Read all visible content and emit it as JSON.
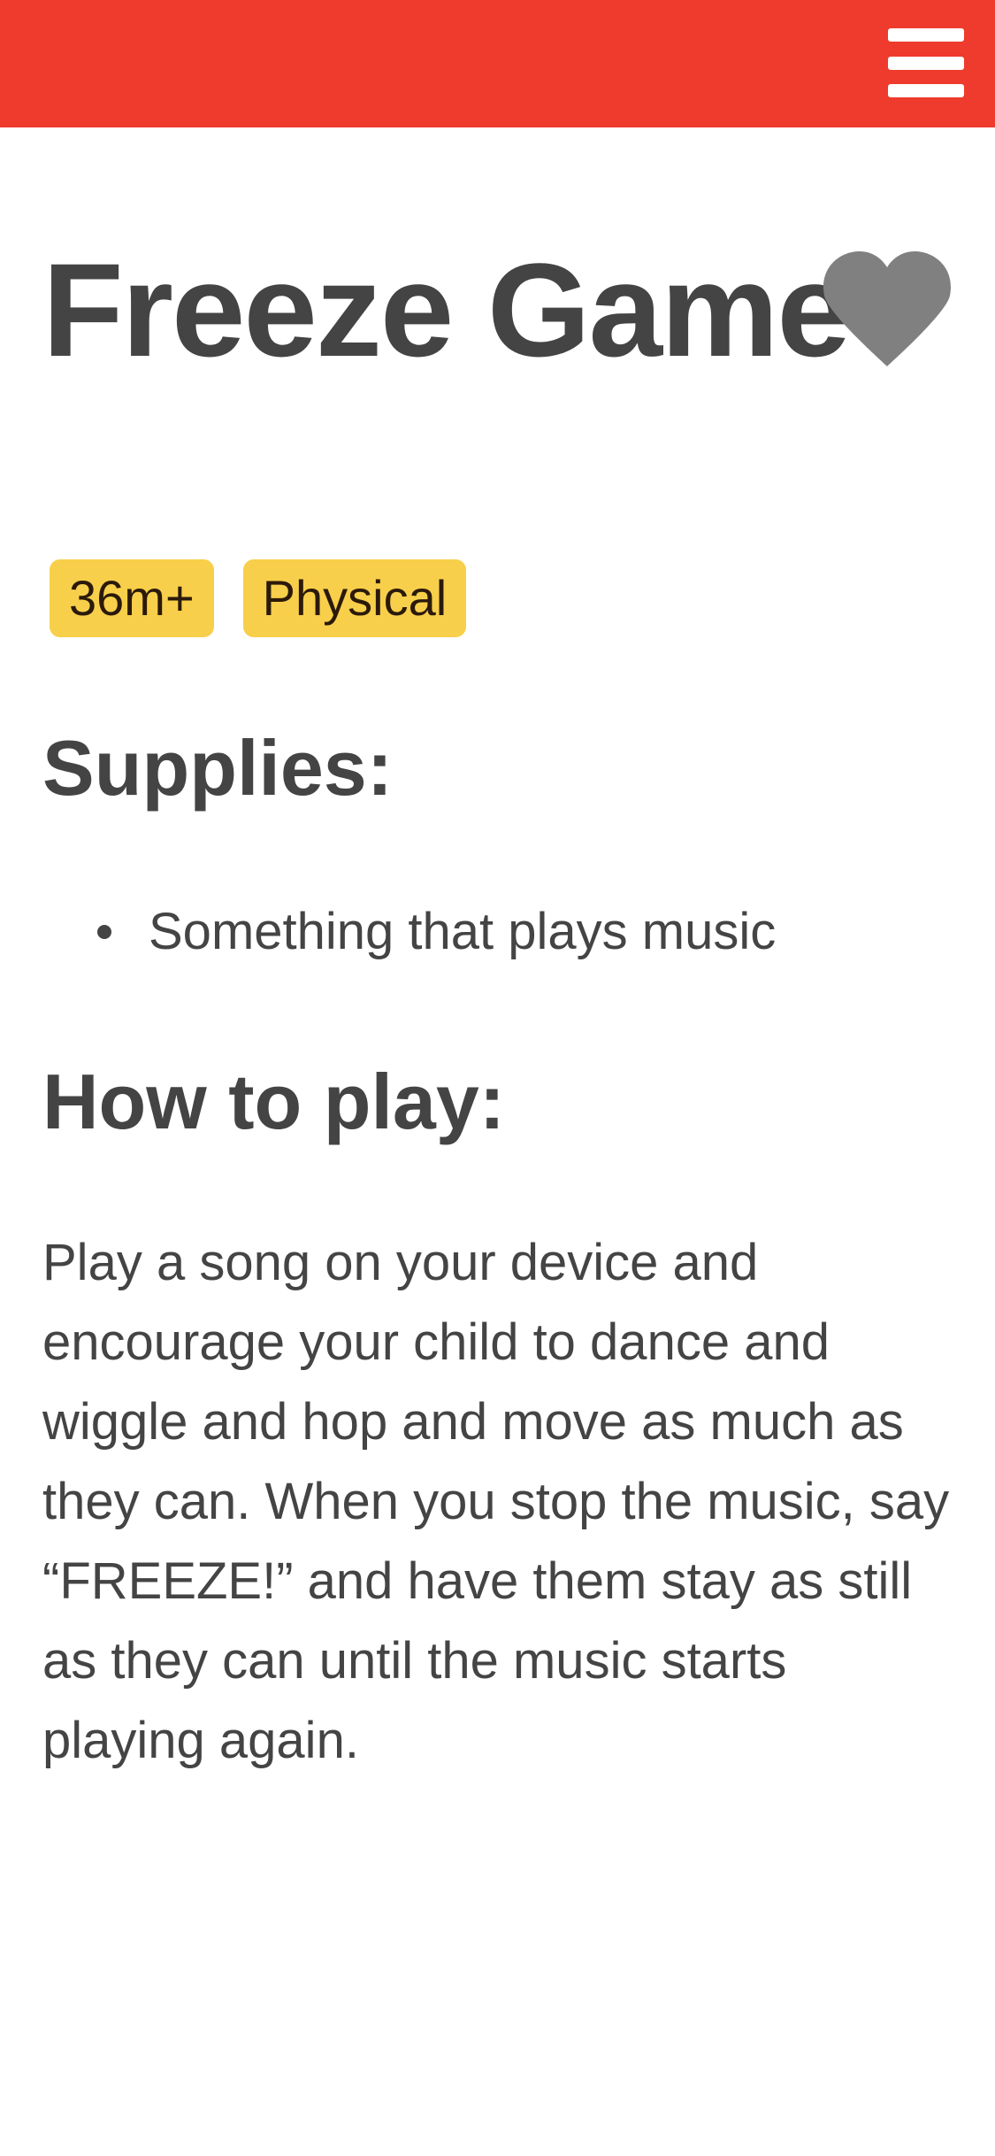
{
  "colors": {
    "topbar": "#ee3b2d",
    "tag_bg": "#f8cf4a",
    "text": "#444444",
    "heart": "#808080"
  },
  "header": {
    "menu_icon": "hamburger-menu-icon"
  },
  "activity": {
    "title": "Freeze Game",
    "favorite_icon": "heart-icon",
    "tags": [
      "36m+",
      "Physical"
    ]
  },
  "supplies": {
    "heading": "Supplies:",
    "items": [
      "Something that plays music"
    ]
  },
  "how_to_play": {
    "heading": "How to play:",
    "text": "Play a song on your device and encourage your child to dance and wiggle and hop and move as much as they can. When you stop the music, say “FREEZE!” and have them stay as still as they can until the music starts playing again."
  }
}
